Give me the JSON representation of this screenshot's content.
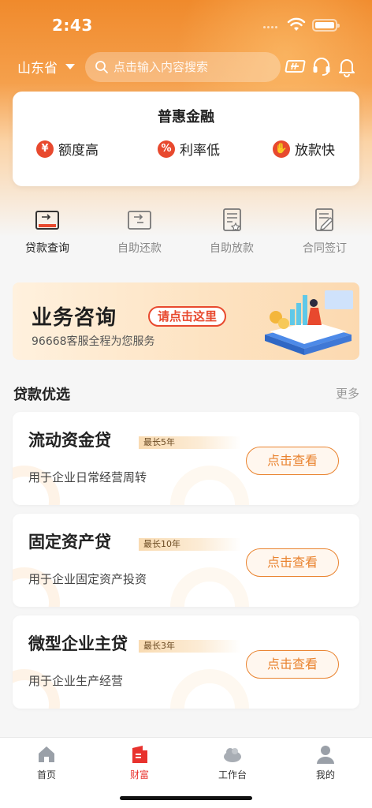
{
  "status_bar": {
    "time": "2:43"
  },
  "header": {
    "province": "山东省",
    "search_placeholder": "点击输入内容搜索",
    "icons": [
      "scan-icon",
      "headset-icon",
      "bell-icon"
    ]
  },
  "benefits": {
    "title": "普惠金融",
    "items": [
      {
        "icon": "yen-bag-icon",
        "label": "额度高"
      },
      {
        "icon": "percent-icon",
        "label": "利率低"
      },
      {
        "icon": "hand-coin-icon",
        "label": "放款快"
      }
    ]
  },
  "quick_menu": [
    {
      "icon": "loan-query-icon",
      "label": "贷款查询",
      "active": true
    },
    {
      "icon": "repay-icon",
      "label": "自助还款",
      "active": false
    },
    {
      "icon": "disburse-icon",
      "label": "自助放款",
      "active": false
    },
    {
      "icon": "contract-icon",
      "label": "合同签订",
      "active": false
    }
  ],
  "banner": {
    "title": "业务咨询",
    "cta": "请点击这里",
    "subtitle": "96668客服全程为您服务"
  },
  "section": {
    "title": "贷款优选",
    "more": "更多"
  },
  "loans": [
    {
      "name": "流动资金贷",
      "tag": "最长5年",
      "desc": "用于企业日常经营周转",
      "button": "点击查看"
    },
    {
      "name": "固定资产贷",
      "tag": "最长10年",
      "desc": "用于企业固定资产投资",
      "button": "点击查看"
    },
    {
      "name": "微型企业主贷",
      "tag": "最长3年",
      "desc": "用于企业生产经营",
      "button": "点击查看"
    }
  ],
  "tabs": [
    {
      "icon": "home-icon",
      "label": "首页",
      "active": false
    },
    {
      "icon": "wealth-icon",
      "label": "财富",
      "active": true
    },
    {
      "icon": "workbench-icon",
      "label": "工作台",
      "active": false
    },
    {
      "icon": "profile-icon",
      "label": "我的",
      "active": false
    }
  ],
  "colors": {
    "brand_orange": "#f08a2c",
    "accent_red": "#e8322e",
    "button_orange": "#e9832f"
  }
}
